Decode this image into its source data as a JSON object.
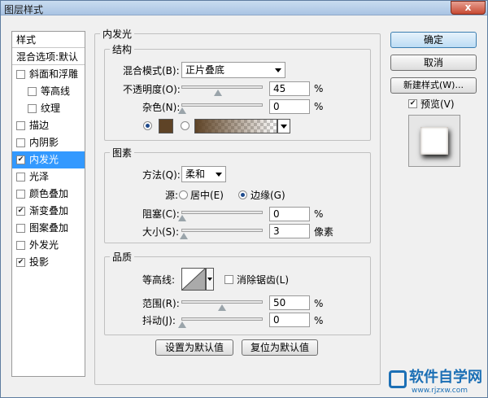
{
  "window": {
    "title": "图层样式",
    "close_glyph": "x"
  },
  "left_panel": {
    "header": "样式",
    "blend_options": "混合选项:默认",
    "items": [
      {
        "label": "斜面和浮雕",
        "checked": false,
        "selected": false,
        "indent": false
      },
      {
        "label": "等高线",
        "checked": false,
        "selected": false,
        "indent": true
      },
      {
        "label": "纹理",
        "checked": false,
        "selected": false,
        "indent": true
      },
      {
        "label": "描边",
        "checked": false,
        "selected": false,
        "indent": false
      },
      {
        "label": "内阴影",
        "checked": false,
        "selected": false,
        "indent": false
      },
      {
        "label": "内发光",
        "checked": true,
        "selected": true,
        "indent": false
      },
      {
        "label": "光泽",
        "checked": false,
        "selected": false,
        "indent": false
      },
      {
        "label": "颜色叠加",
        "checked": false,
        "selected": false,
        "indent": false
      },
      {
        "label": "渐变叠加",
        "checked": true,
        "selected": false,
        "indent": false
      },
      {
        "label": "图案叠加",
        "checked": false,
        "selected": false,
        "indent": false
      },
      {
        "label": "外发光",
        "checked": false,
        "selected": false,
        "indent": false
      },
      {
        "label": "投影",
        "checked": true,
        "selected": false,
        "indent": false
      }
    ]
  },
  "inner_glow": {
    "title": "内发光",
    "structure": {
      "title": "结构",
      "blend_mode_label": "混合模式(B):",
      "blend_mode_value": "正片叠底",
      "opacity_label": "不透明度(O):",
      "opacity_value": "45",
      "opacity_level": 0.45,
      "noise_label": "杂色(N):",
      "noise_value": "0",
      "noise_level": 0,
      "percent": "%",
      "glow_color": "#5e4326"
    },
    "elements": {
      "title": "图素",
      "technique_label": "方法(Q):",
      "technique_value": "柔和",
      "source_label": "源:",
      "source_center": "居中(E)",
      "source_edge": "边缘(G)",
      "choke_label": "阻塞(C):",
      "choke_value": "0",
      "choke_level": 0,
      "size_label": "大小(S):",
      "size_value": "3",
      "size_unit": "像素",
      "size_level": 0.02
    },
    "quality": {
      "title": "品质",
      "contour_label": "等高线:",
      "anti_alias_label": "消除锯齿(L)",
      "range_label": "范围(R):",
      "range_value": "50",
      "range_level": 0.5,
      "jitter_label": "抖动(J):",
      "jitter_value": "0",
      "jitter_level": 0
    },
    "make_default": "设置为默认值",
    "reset_default": "复位为默认值"
  },
  "right_panel": {
    "ok": "确定",
    "cancel": "取消",
    "new_style": "新建样式(W)...",
    "preview_label": "预览(V)",
    "preview_checked": true
  },
  "watermark": {
    "brand": "软件自学网",
    "url": "www.rjzxw.com"
  }
}
